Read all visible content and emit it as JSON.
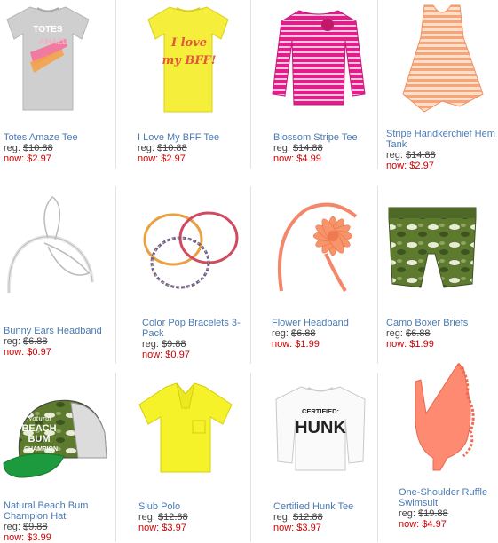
{
  "products": [
    {
      "name": "Totes Amaze Tee",
      "reg_label": "reg: ",
      "reg": "$10.88",
      "now_label": "now: ",
      "now": "$2.97",
      "icon": "gray-tee-icon"
    },
    {
      "name": "I Love My BFF Tee",
      "reg_label": "reg: ",
      "reg": "$10.88",
      "now_label": "now: ",
      "now": "$2.97",
      "icon": "yellow-tee-icon",
      "print_line1": "I love",
      "print_line2": "my BFF!"
    },
    {
      "name": "Blossom Stripe Tee",
      "reg_label": "reg: ",
      "reg": "$14.88",
      "now_label": "now: ",
      "now": "$4.99",
      "icon": "pink-stripe-tee-icon"
    },
    {
      "name": "Stripe Handkerchief Hem Tank",
      "reg_label": "reg: ",
      "reg": "$14.88",
      "now_label": "now: ",
      "now": "$2.97",
      "icon": "stripe-tank-icon"
    },
    {
      "name": "Bunny Ears Headband",
      "reg_label": "reg: ",
      "reg": "$6.88",
      "now_label": "now: ",
      "now": "$0.97",
      "icon": "bunny-ears-headband-icon"
    },
    {
      "name": "Color Pop Bracelets 3-Pack",
      "reg_label": "reg: ",
      "reg": "$9.88",
      "now_label": "now: ",
      "now": "$0.97",
      "icon": "bracelets-icon"
    },
    {
      "name": "Flower Headband",
      "reg_label": "reg: ",
      "reg": "$6.88",
      "now_label": "now: ",
      "now": "$1.99",
      "icon": "flower-headband-icon"
    },
    {
      "name": "Camo Boxer Briefs",
      "reg_label": "reg: ",
      "reg": "$6.88",
      "now_label": "now: ",
      "now": "$1.99",
      "icon": "camo-boxer-icon"
    },
    {
      "name": "Natural Beach Bum Champion Hat",
      "reg_label": "reg: ",
      "reg": "$9.88",
      "now_label": "now: ",
      "now": "$3.99",
      "icon": "camo-cap-icon",
      "print_line1": "Natural",
      "print_line2": "BEACH",
      "print_line3": "BUM",
      "print_line4": "CHAMPION"
    },
    {
      "name": "Slub Polo",
      "reg_label": "reg: ",
      "reg": "$12.88",
      "now_label": "now: ",
      "now": "$3.97",
      "icon": "yellow-polo-icon"
    },
    {
      "name": "Certified Hunk Tee",
      "reg_label": "reg: ",
      "reg": "$12.88",
      "now_label": "now: ",
      "now": "$3.97",
      "icon": "white-hunk-tee-icon",
      "print_line1": "CERTIFIED:",
      "print_line2": "HUNK"
    },
    {
      "name": "One-Shoulder Ruffle Swimsuit",
      "reg_label": "reg: ",
      "reg": "$19.88",
      "now_label": "now: ",
      "now": "$4.97",
      "icon": "ruffle-swimsuit-icon"
    }
  ],
  "colors": {
    "link": "#4a7ab3",
    "sale": "#cc0000",
    "divider": "#e3e3e3"
  }
}
